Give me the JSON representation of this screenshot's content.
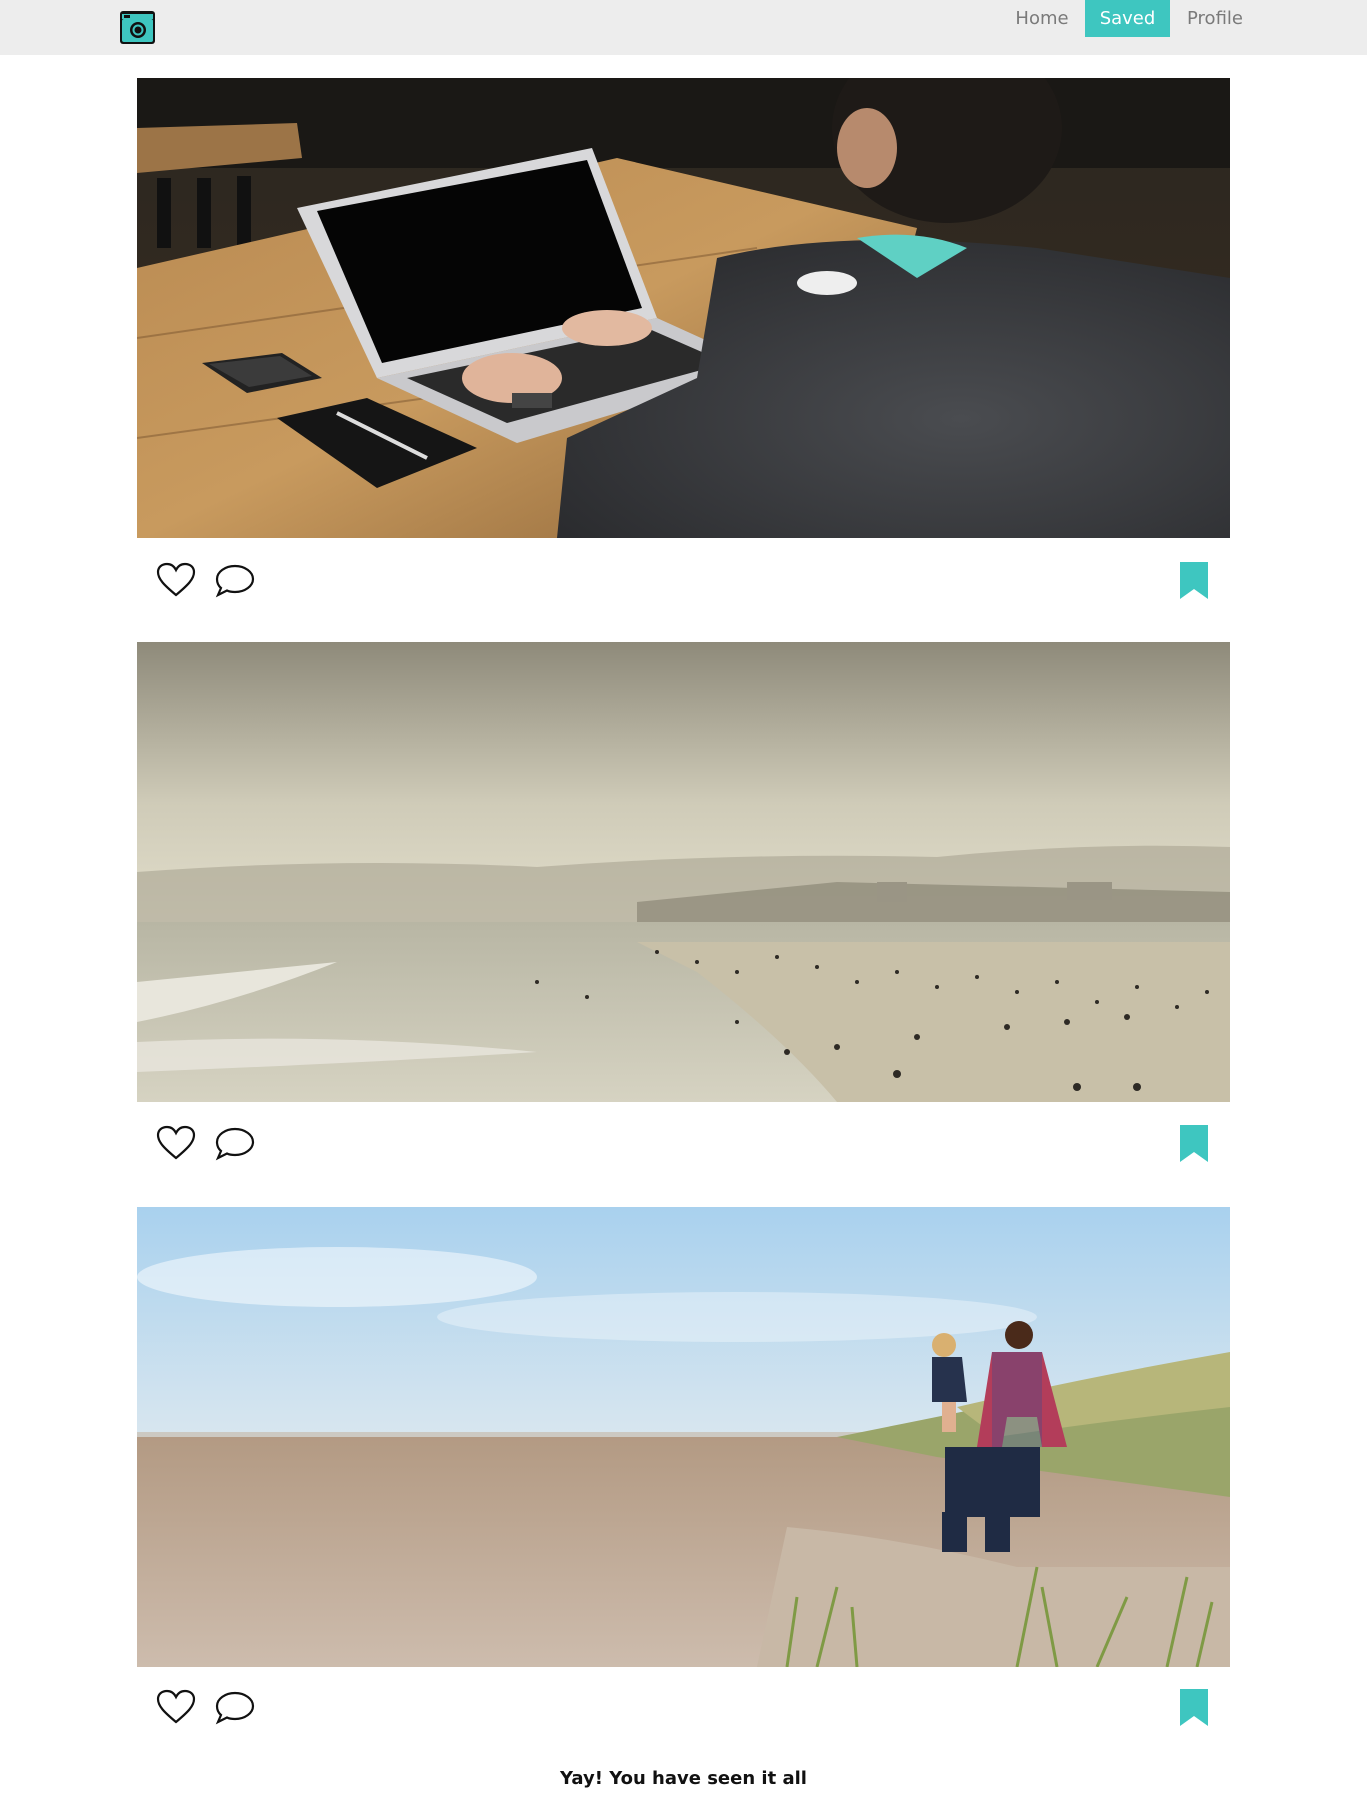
{
  "navbar": {
    "logo_icon": "camera-icon",
    "links": [
      {
        "label": "Home",
        "active": false
      },
      {
        "label": "Saved",
        "active": true
      },
      {
        "label": "Profile",
        "active": false
      }
    ],
    "accent_color": "#3ec6c0",
    "background": "#ededed"
  },
  "posts": [
    {
      "image": "person typing on laptop at wooden table",
      "actions": {
        "like_icon": "heart-icon",
        "comment_icon": "speech-bubble-icon",
        "save_icon": "bookmark-icon",
        "saved": true
      }
    },
    {
      "image": "hazy beach with swimmers",
      "actions": {
        "like_icon": "heart-icon",
        "comment_icon": "speech-bubble-icon",
        "save_icon": "bookmark-icon",
        "saved": true
      }
    },
    {
      "image": "father carrying child on sandy beach",
      "actions": {
        "like_icon": "heart-icon",
        "comment_icon": "speech-bubble-icon",
        "save_icon": "bookmark-icon",
        "saved": true
      }
    }
  ],
  "footer": {
    "end_message": "Yay! You have seen it all"
  }
}
